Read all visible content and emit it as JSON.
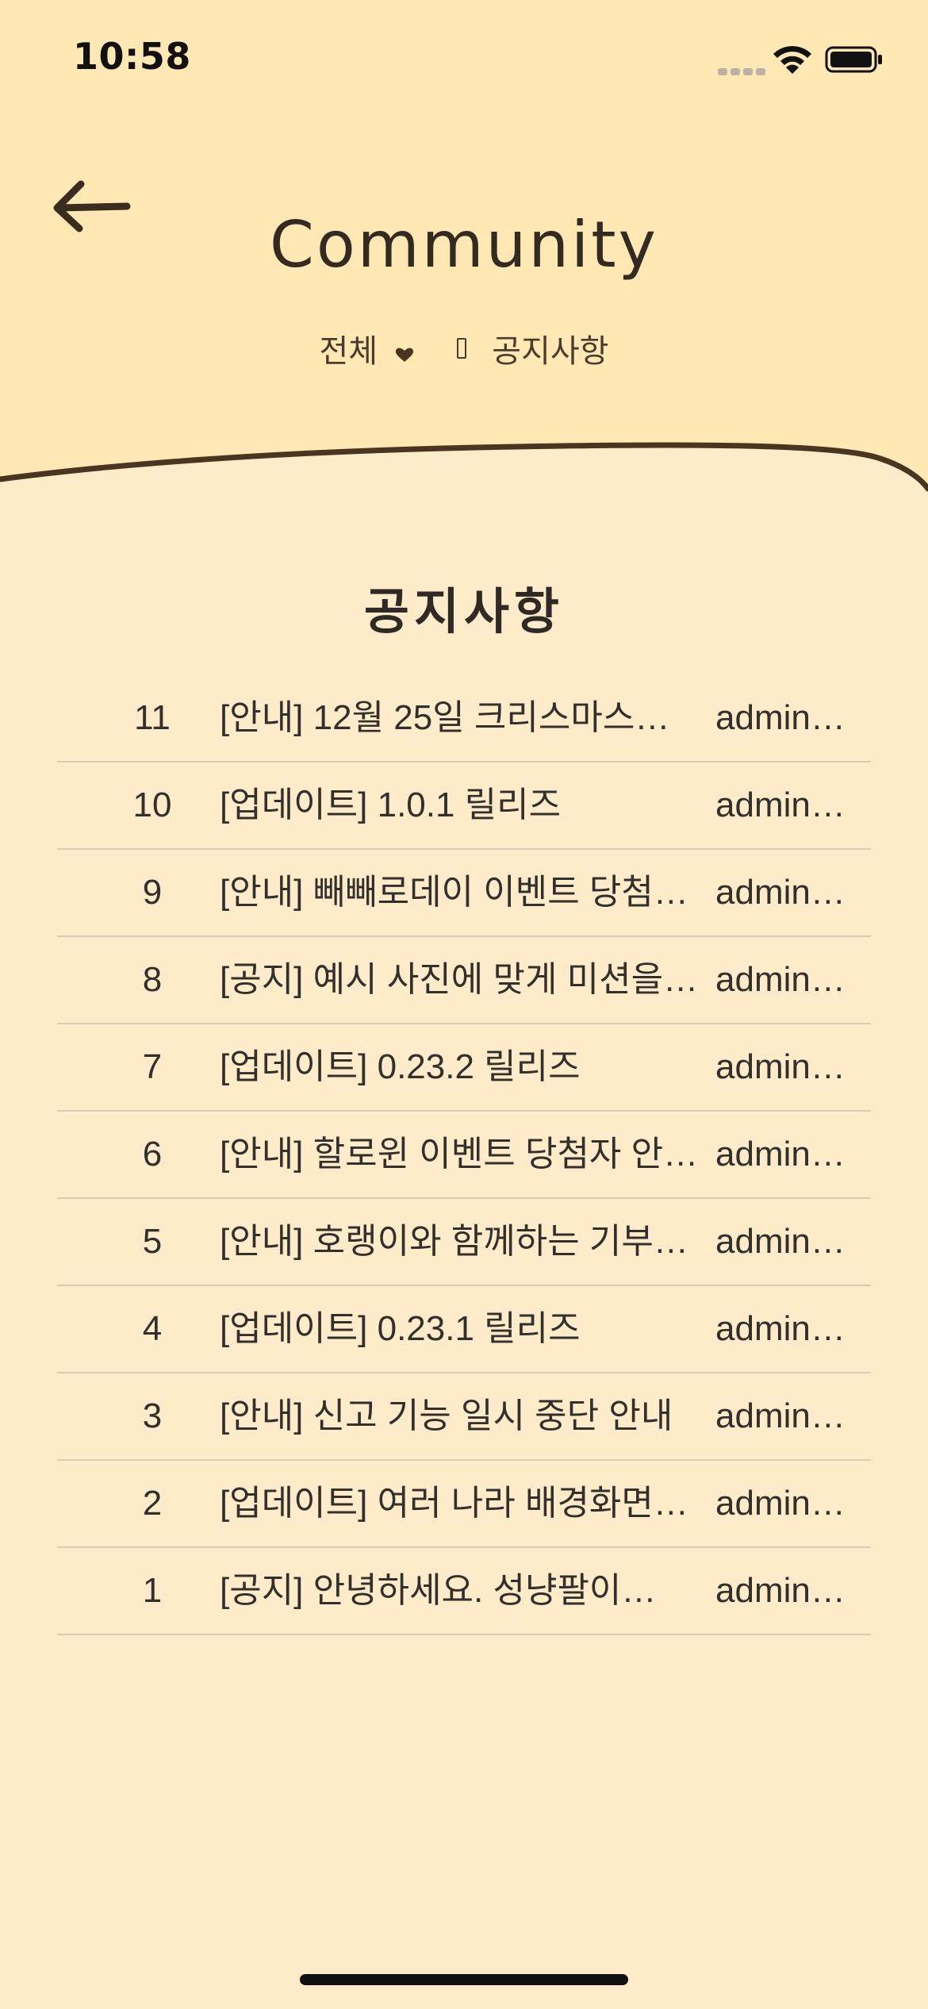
{
  "status_bar": {
    "time": "10:58"
  },
  "header": {
    "title": "Community",
    "breadcrumb": {
      "category": "전체",
      "board": "공지사항"
    }
  },
  "section": {
    "title": "공지사항"
  },
  "posts": [
    {
      "num": "11",
      "subject": "[안내] 12월 25일 크리스마스…",
      "author": "admin…"
    },
    {
      "num": "10",
      "subject": "[업데이트] 1.0.1 릴리즈",
      "author": "admin…"
    },
    {
      "num": "9",
      "subject": "[안내] 빼빼로데이 이벤트 당첨…",
      "author": "admin…"
    },
    {
      "num": "8",
      "subject": "[공지] 예시 사진에 맞게 미션을…",
      "author": "admin…"
    },
    {
      "num": "7",
      "subject": "[업데이트] 0.23.2 릴리즈",
      "author": "admin…"
    },
    {
      "num": "6",
      "subject": "[안내] 할로윈 이벤트 당첨자 안…",
      "author": "admin…"
    },
    {
      "num": "5",
      "subject": "[안내] 호랭이와 함께하는 기부…",
      "author": "admin…"
    },
    {
      "num": "4",
      "subject": "[업데이트] 0.23.1 릴리즈",
      "author": "admin…"
    },
    {
      "num": "3",
      "subject": "[안내] 신고 기능 일시 중단 안내",
      "author": "admin…"
    },
    {
      "num": "2",
      "subject": "[업데이트] 여러 나라 배경화면…",
      "author": "admin…"
    },
    {
      "num": "1",
      "subject": "[공지] 안녕하세요. 성냥팔이…",
      "author": "admin…"
    }
  ],
  "colors": {
    "header_bg": "#ffe8b3",
    "body_bg": "#fdebc9",
    "wave_stroke": "#4a3520",
    "divider": "#d9ccb4"
  },
  "icons": [
    "back-arrow-icon",
    "heart-icon",
    "wifi-icon",
    "battery-icon",
    "cellular-signal-icon"
  ]
}
